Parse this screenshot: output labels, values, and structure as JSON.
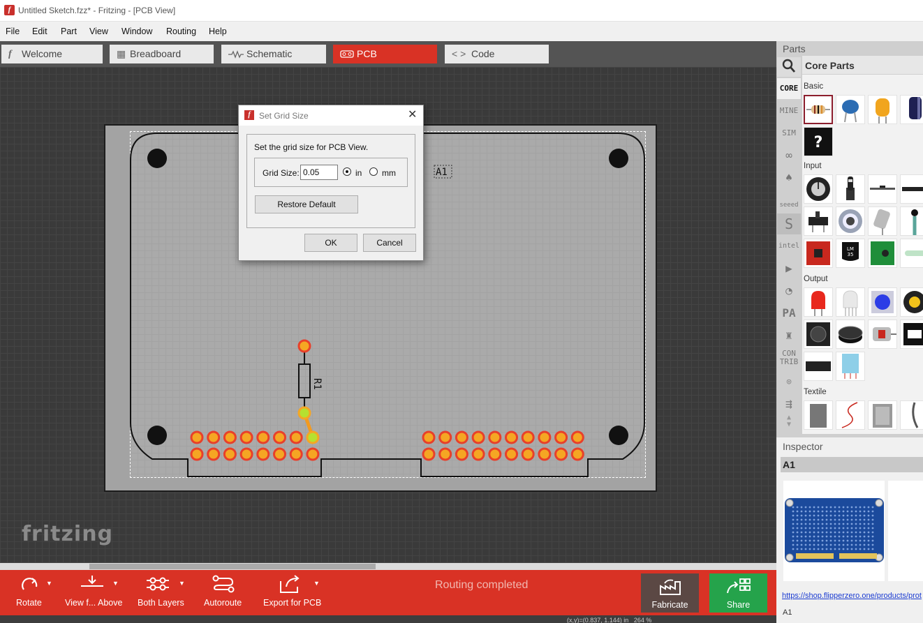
{
  "window": {
    "title": "Untitled Sketch.fzz* - Fritzing - [PCB View]"
  },
  "menu": [
    "File",
    "Edit",
    "Part",
    "View",
    "Window",
    "Routing",
    "Help"
  ],
  "tabs": [
    {
      "label": "Welcome",
      "icon": "fritzing-f-icon"
    },
    {
      "label": "Breadboard",
      "icon": "breadboard-icon"
    },
    {
      "label": "Schematic",
      "icon": "resistor-zigzag-icon"
    },
    {
      "label": "PCB",
      "icon": "pcb-icon"
    },
    {
      "label": "Code",
      "icon": "code-brackets-icon"
    }
  ],
  "canvas": {
    "part_label": "A1",
    "resistor_label": "R1",
    "watermark": "fritzing"
  },
  "dialog": {
    "title": "Set Grid Size",
    "message": "Set the grid size for PCB View.",
    "grid_label": "Grid Size:",
    "grid_value": "0.05",
    "unit_in": "in",
    "unit_mm": "mm",
    "selected_unit": "in",
    "restore_default": "Restore Default",
    "ok": "OK",
    "cancel": "Cancel"
  },
  "toolbar": {
    "rotate": "Rotate",
    "view_from": "View f... Above",
    "layers": "Both Layers",
    "autoroute": "Autoroute",
    "export": "Export for PCB",
    "status": "Routing completed",
    "fabricate": "Fabricate",
    "share": "Share"
  },
  "statusbar": {
    "coords": "(x,y)=(0.837, 1.144) in",
    "zoom": "264 %"
  },
  "parts": {
    "header": "Parts",
    "bin_title": "Core Parts",
    "bins": [
      "CORE",
      "MINE",
      "SIM",
      "CON TRIB"
    ],
    "categories": [
      "Basic",
      "Input",
      "Output",
      "Textile"
    ]
  },
  "inspector": {
    "header": "Inspector",
    "title": "A1",
    "link": "https://shop.flipperzero.one/products/prot",
    "name": "A1"
  },
  "colors": {
    "accent": "#d93225",
    "share": "#25a34b",
    "fabricate": "#5b4844",
    "pad": "#f5a623",
    "pad_ring": "#e8402a"
  }
}
